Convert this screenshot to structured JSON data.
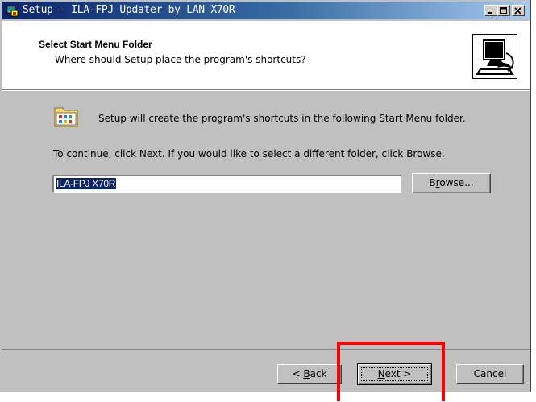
{
  "window": {
    "title": "Setup - ILA-FPJ Updater by LAN X70R",
    "controls": [
      "minimize-icon",
      "maximize-icon",
      "close-icon"
    ]
  },
  "header": {
    "title": "Select Start Menu Folder",
    "subtitle": "Where should Setup place the program's shortcuts?"
  },
  "body": {
    "info_text": "Setup will create the program's shortcuts in the following Start Menu folder.",
    "instruction_text": "To continue, click Next. If you would like to select a different folder, click Browse.",
    "folder_value": "ILA-FPJ X70R"
  },
  "buttons": {
    "browse_pre": "B",
    "browse_u": "r",
    "browse_post": "owse...",
    "back_pre": "< ",
    "back_u": "B",
    "back_post": "ack",
    "next_u": "N",
    "next_post": "ext >",
    "cancel": "Cancel"
  },
  "colors": {
    "titlebar_start": "#0a246a",
    "titlebar_end": "#a6caf0",
    "face": "#c0c0c0",
    "highlight_box": "#ff0000"
  }
}
